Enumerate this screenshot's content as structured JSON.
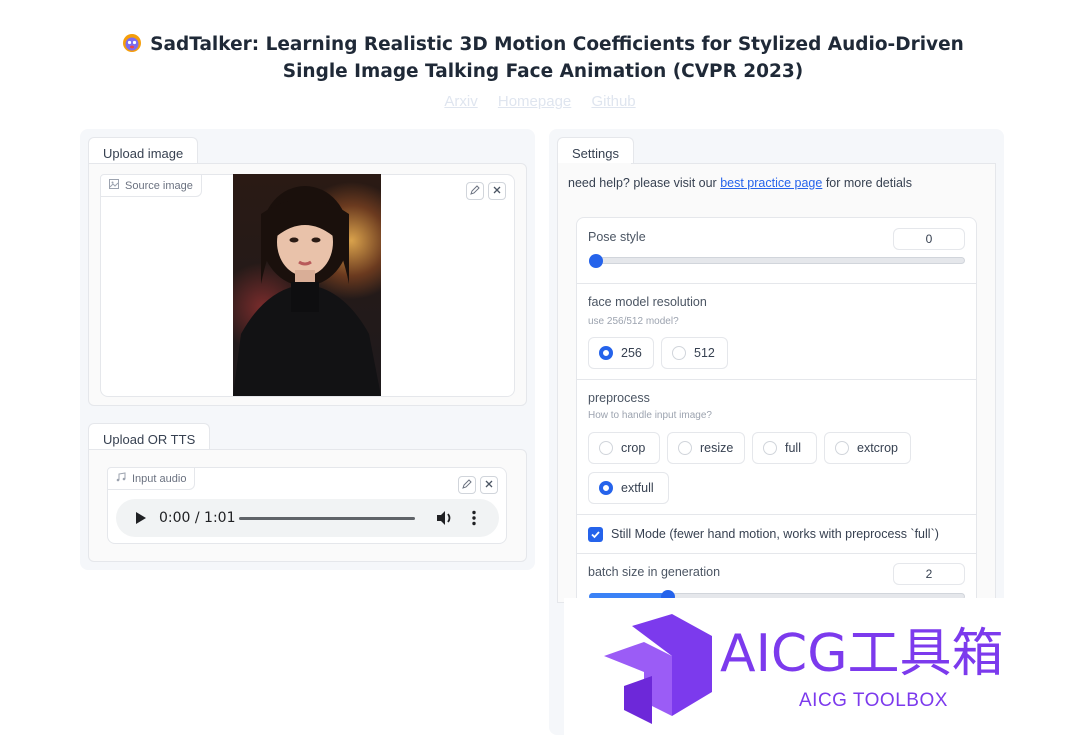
{
  "header": {
    "title": "SadTalker: Learning Realistic 3D Motion Coefficients for Stylized Audio-Driven Single Image Talking Face Animation (CVPR 2023)",
    "links": [
      "Arxiv",
      "Homepage",
      "Github"
    ]
  },
  "left": {
    "upload_tab": "Upload image",
    "source_label": "Source image",
    "tts_tab": "Upload OR TTS",
    "audio_label": "Input audio",
    "audio_time": "0:00 / 1:01",
    "audio_progress": 0
  },
  "settings": {
    "tab": "Settings",
    "help_prefix": "need help? please visit our ",
    "help_link": "best practice page",
    "help_suffix": " for more detials",
    "pose_style": {
      "label": "Pose style",
      "value": "0",
      "fraction": 0.0
    },
    "face_model": {
      "label": "face model resolution",
      "info": "use 256/512 model?",
      "options": [
        "256",
        "512"
      ],
      "selected": "256"
    },
    "preprocess": {
      "label": "preprocess",
      "info": "How to handle input image?",
      "options": [
        "crop",
        "resize",
        "full",
        "extcrop",
        "extfull"
      ],
      "selected": "extfull"
    },
    "still_mode": {
      "label": "Still Mode (fewer hand motion, works with preprocess `full`)",
      "checked": true
    },
    "batch_size": {
      "label": "batch size in generation",
      "value": "2",
      "fraction": 0.2
    }
  },
  "watermark": {
    "title": "AICG工具箱",
    "subtitle": "AICG TOOLBOX"
  },
  "colors": {
    "accent": "#2563eb",
    "watermark": "#7c3aed",
    "link": "#2563eb"
  }
}
